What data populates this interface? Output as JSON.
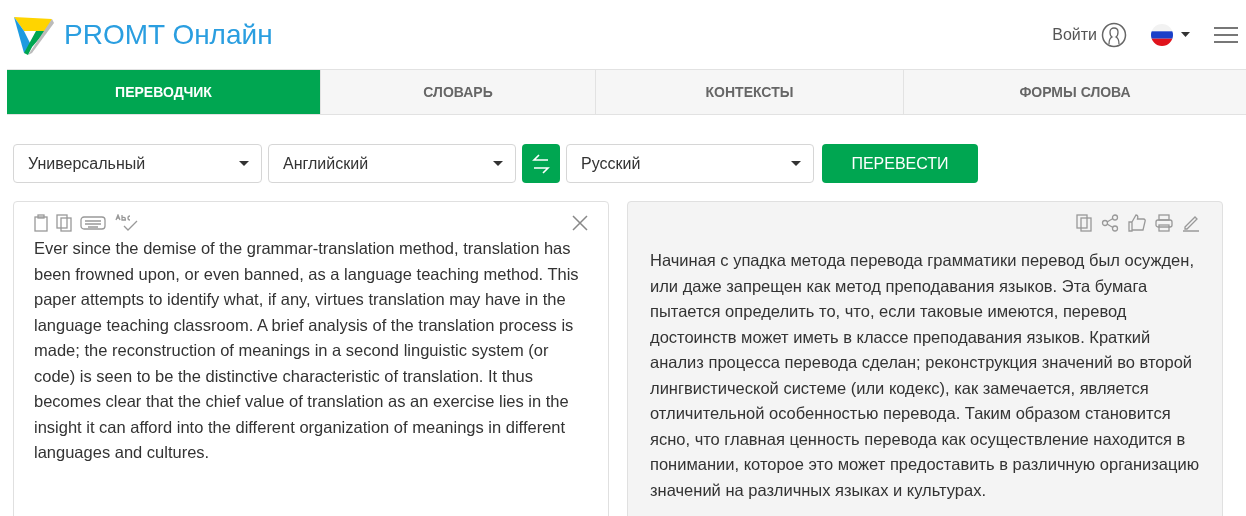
{
  "header": {
    "brand": "PROMT Онлайн",
    "login": "Войти"
  },
  "tabs": [
    {
      "label": "ПЕРЕВОДЧИК",
      "selected": true
    },
    {
      "label": "СЛОВАРЬ",
      "selected": false
    },
    {
      "label": "КОНТЕКСТЫ",
      "selected": false
    },
    {
      "label": "ФОРМЫ СЛОВА",
      "selected": false
    }
  ],
  "controls": {
    "topic": "Универсальный",
    "source_language": "Английский",
    "target_language": "Русский",
    "translate_button": "ПЕРЕВЕСТИ"
  },
  "source": {
    "text": "Ever since the demise of the grammar-translation method, translation has been frowned upon, or even banned, as a language teaching method. This paper attempts to identify what, if any, virtues translation may have in the language teaching classroom. A brief analysis of the translation process is made; the reconstruction of meanings in a second linguistic system (or code) is seen to be the distinctive characteristic of translation. It thus becomes clear that the chief value of translation as an exercise lies in the insight it can afford into the different organization of meanings in different languages and cultures."
  },
  "result": {
    "text": "Начиная с упадка метода перевода грамматики перевод был осужден, или даже запрещен как метод преподавания языков. Эта бумага пытается определить то, что, если таковые имеются, перевод достоинств может иметь в классе преподавания языков. Краткий анализ процесса перевода сделан; реконструкция значений во второй лингвистической системе (или кодекс), как замечается, является отличительной особенностью перевода. Таким образом становится ясно, что главная ценность перевода как осуществление находится в понимании, которое это может предоставить в различную организацию значений на различных языках и культурах."
  }
}
